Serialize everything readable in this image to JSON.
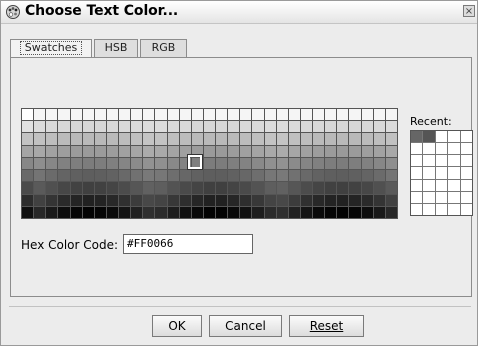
{
  "window": {
    "title": "Choose Text Color...",
    "close_symbol": "×",
    "icon": "palette-icon"
  },
  "tabs": [
    {
      "label": "Swatches",
      "active": true
    },
    {
      "label": "HSB",
      "active": false
    },
    {
      "label": "RGB",
      "active": false
    }
  ],
  "swatches": {
    "columns": 31,
    "rows": 9,
    "selected": {
      "row": 4,
      "column": 15
    }
  },
  "recent": {
    "label": "Recent:",
    "colors": [
      "#666666",
      "#555555"
    ]
  },
  "hex": {
    "label": "Hex Color Code:",
    "value": "#FF0066"
  },
  "buttons": {
    "ok": "OK",
    "cancel": "Cancel",
    "reset": "Reset"
  }
}
